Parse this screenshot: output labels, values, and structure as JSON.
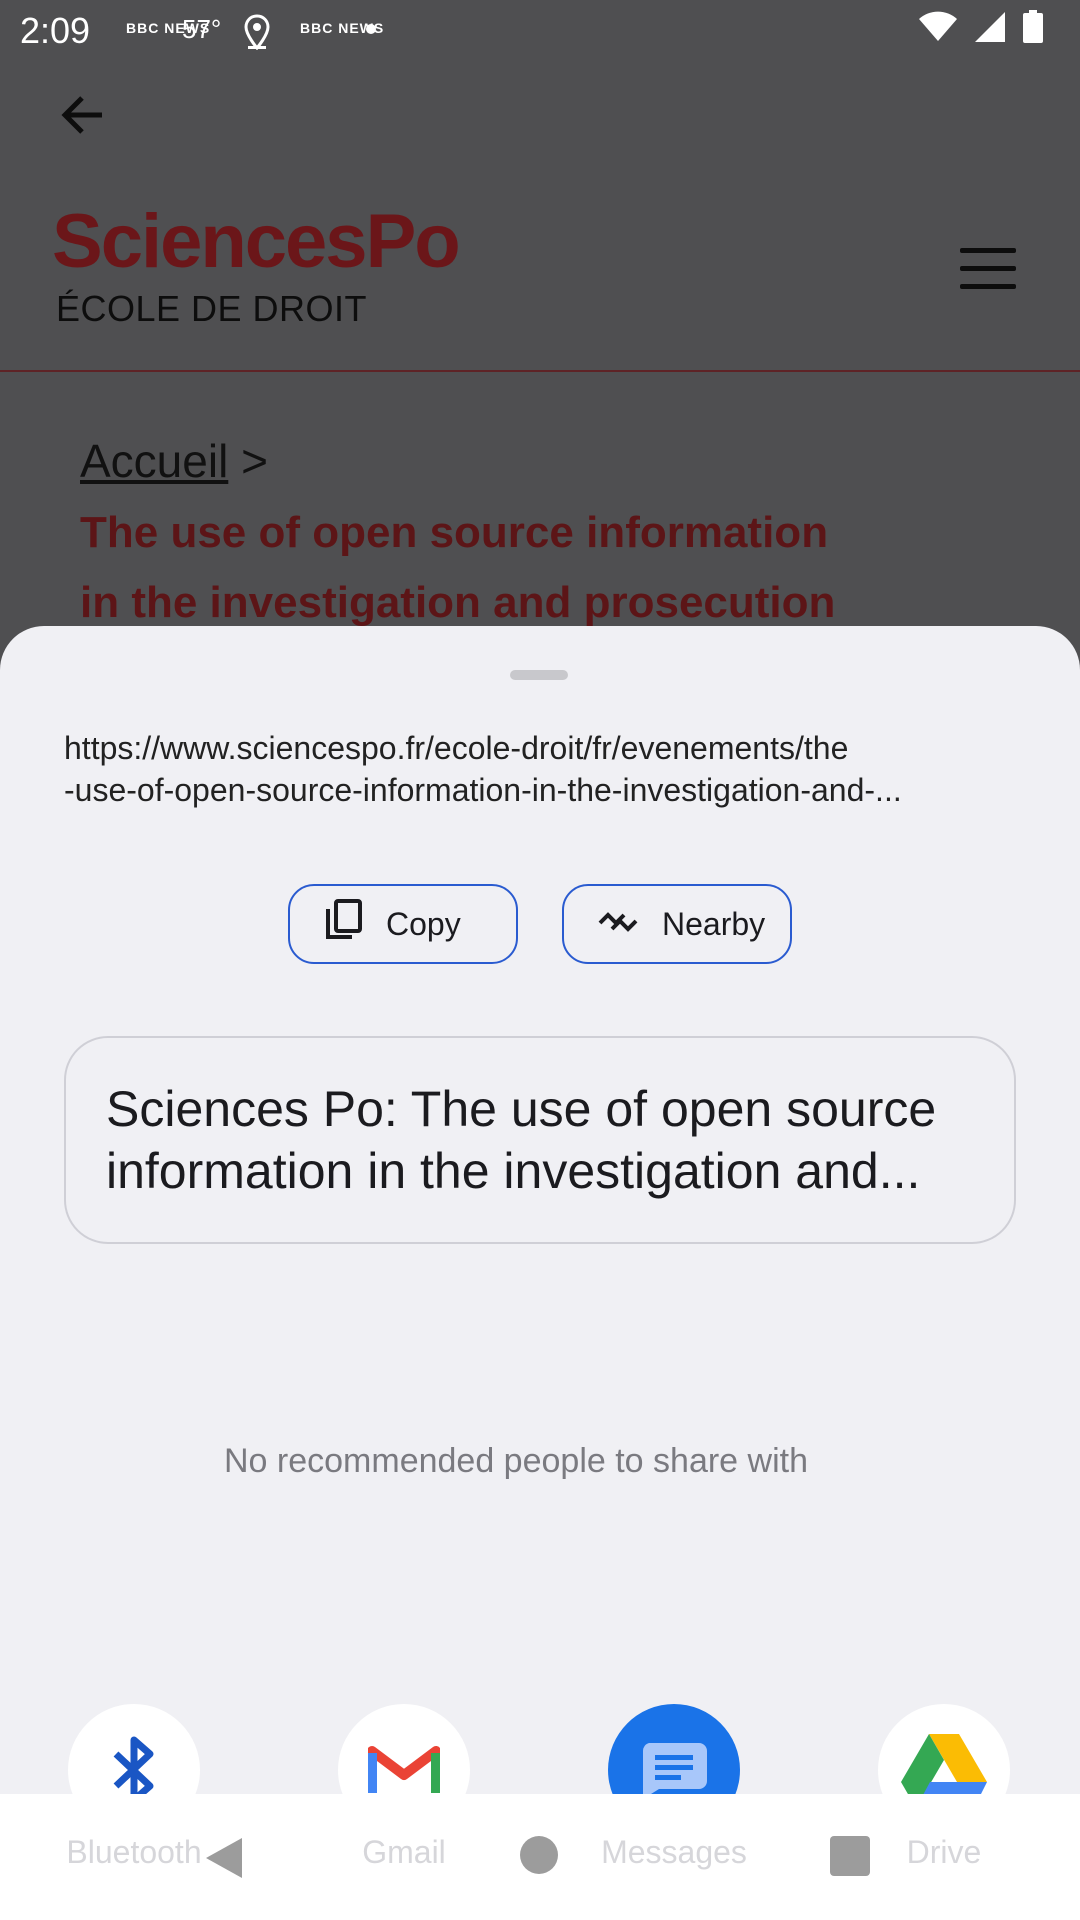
{
  "status_bar": {
    "time": "2:09",
    "news_badge_1": "BBC NEWS",
    "temperature": "57°",
    "news_badge_2": "BBC NEWS"
  },
  "webpage": {
    "logo": "SciencesPo",
    "logo_subtitle": "ÉCOLE DE DROIT",
    "breadcrumb_link": "Accueil",
    "breadcrumb_sep": " >",
    "headline_line1": "The use of open source information",
    "headline_line2": "in the investigation and prosecution",
    "colors": {
      "brand": "#6b1619",
      "overlay": "#4f4f51"
    }
  },
  "share_sheet": {
    "url_line1": "https://www.sciencespo.fr/ecole-droit/fr/evenements/the",
    "url_line2": "-use-of-open-source-information-in-the-investigation-and-...",
    "actions": {
      "copy_label": "Copy",
      "copy_icon": "copy-icon",
      "nearby_label": "Nearby",
      "nearby_icon": "nearby-share-icon"
    },
    "preview_line1": "Sciences Po: The use of open source",
    "preview_line2": "information in the investigation and...",
    "empty_people": "No recommended people to share with",
    "apps": [
      {
        "label": "Bluetooth",
        "icon": "bluetooth-icon"
      },
      {
        "label": "Gmail",
        "icon": "gmail-icon"
      },
      {
        "label": "Messages",
        "icon": "messages-icon"
      },
      {
        "label": "Drive",
        "icon": "drive-icon"
      }
    ],
    "colors": {
      "accent": "#2a5bd0",
      "sheet_bg": "#f0f0f4"
    }
  }
}
